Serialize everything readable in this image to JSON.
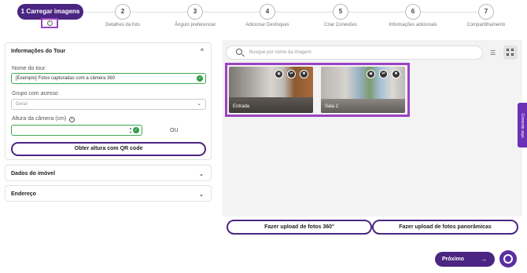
{
  "stepper": {
    "active": {
      "number": "1",
      "label": "Carregar imagens"
    },
    "steps": [
      {
        "number": "2",
        "label": "Detalhes da foto"
      },
      {
        "number": "3",
        "label": "Ângulo preferencial"
      },
      {
        "number": "4",
        "label": "Adicionar Desfoques"
      },
      {
        "number": "5",
        "label": "Criar Conexões"
      },
      {
        "number": "6",
        "label": "Informações adicionais"
      },
      {
        "number": "7",
        "label": "Compartilhamento"
      }
    ]
  },
  "tour_info": {
    "title": "Informações do Tour",
    "name_label": "Nome do tour",
    "name_value": "[Exemplo] Fotos capturadas com a câmera 360",
    "access_label": "Grupo com acesso",
    "access_value": "Geral",
    "height_label": "Altura da câmera (cm)",
    "height_value": "",
    "or_label": "OU",
    "qr_button": "Obter altura com QR code"
  },
  "property_section": {
    "title": "Dados do imóvel"
  },
  "address_section": {
    "title": "Endereço"
  },
  "search": {
    "placeholder": "Busque por nome da imagem"
  },
  "images": [
    {
      "name": "Entrada"
    },
    {
      "name": "Sala 2"
    }
  ],
  "upload": {
    "btn_360": "Fazer upload de fotos 360°",
    "btn_pano": "Fazer upload de fotos panorâmicas"
  },
  "next_button": "Próximo",
  "feedback_tab": "Comente aqui",
  "colors": {
    "primary": "#4b2582",
    "highlight": "#9a44c2",
    "success": "#2ea047"
  }
}
